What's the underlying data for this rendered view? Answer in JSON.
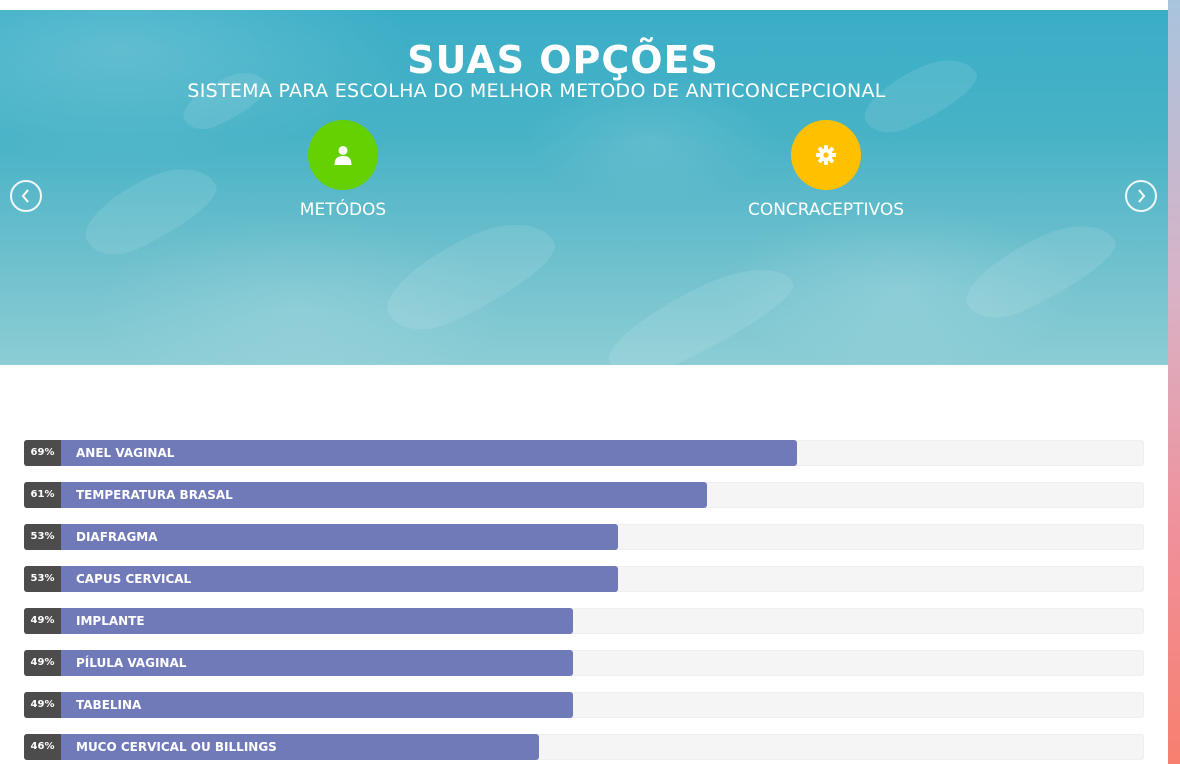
{
  "hero": {
    "title": "SUAS OPÇÕES",
    "subtitle": "SISTEMA PARA ESCOLHA DO MELHOR METODO DE ANTICONCEPCIONAL",
    "options": [
      {
        "label": "METÓDOS",
        "icon": "user-icon",
        "color": "#66d100"
      },
      {
        "label": "CONCRACEPTIVOS",
        "icon": "gear-icon",
        "color": "#ffc000"
      }
    ],
    "prev_icon": "chevron-left-icon",
    "next_icon": "chevron-right-icon"
  },
  "colors": {
    "bar_fill": "#717ab9",
    "percent_badge": "#4c4c4c",
    "bar_track": "#f5f5f5"
  },
  "bars": [
    {
      "label": "ANEL VAGINAL",
      "percent_text": "69%",
      "percent": 69
    },
    {
      "label": "TEMPERATURA BRASAL",
      "percent_text": "61%",
      "percent": 61
    },
    {
      "label": "DIAFRAGMA",
      "percent_text": "53%",
      "percent": 53
    },
    {
      "label": "CAPUS CERVICAL",
      "percent_text": "53%",
      "percent": 53
    },
    {
      "label": "IMPLANTE",
      "percent_text": "49%",
      "percent": 49
    },
    {
      "label": "PÍLULA VAGINAL",
      "percent_text": "49%",
      "percent": 49
    },
    {
      "label": "TABELINA",
      "percent_text": "49%",
      "percent": 49
    },
    {
      "label": "MUCO CERVICAL OU BILLINGS",
      "percent_text": "46%",
      "percent": 46
    }
  ]
}
